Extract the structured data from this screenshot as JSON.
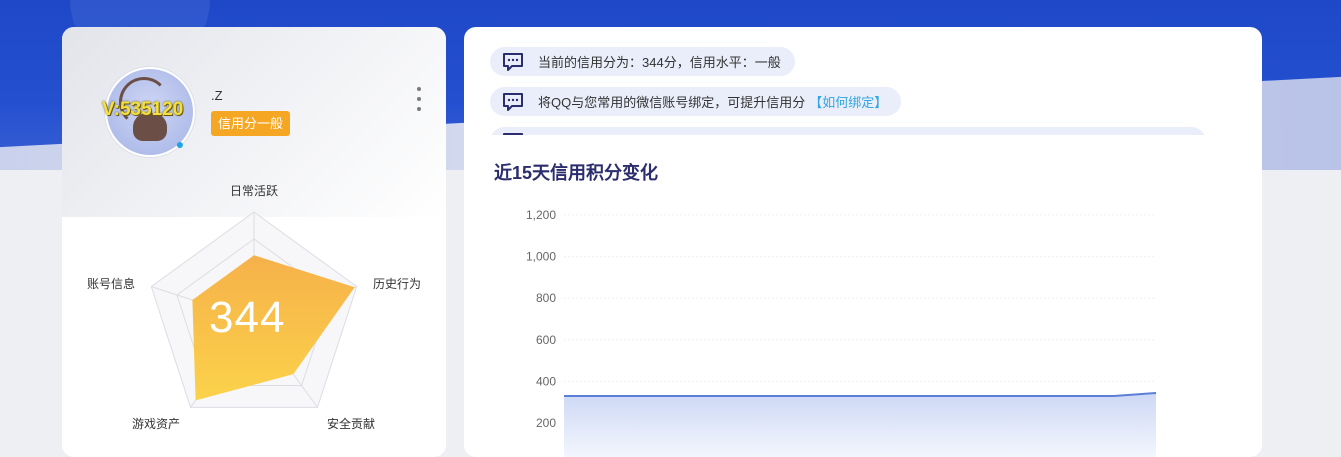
{
  "profile": {
    "vip_text": "V:535120",
    "name": ".Z",
    "credit_level_tag": "信用分一般",
    "score": "344",
    "radar": {
      "dimensions": [
        "日常活跃",
        "历史行为",
        "安全贡献",
        "游戏资产",
        "账号信息"
      ],
      "values": [
        0.6,
        0.98,
        0.62,
        0.92,
        0.6
      ]
    }
  },
  "notices": [
    {
      "text": "当前的信用分为：344分，信用水平：一般",
      "link": ""
    },
    {
      "text": "将QQ与您常用的微信账号绑定，可提升信用分",
      "link": "【如何绑定】"
    }
  ],
  "chart_section_title": "近15天信用积分变化",
  "chart_data": {
    "type": "area",
    "title": "近15天信用积分变化",
    "yticks": [
      "1,200",
      "1,000",
      "800",
      "600",
      "400",
      "200"
    ],
    "ylim": [
      0,
      1200
    ],
    "series": [
      {
        "values": [
          330,
          330,
          330,
          330,
          330,
          330,
          330,
          330,
          330,
          330,
          330,
          330,
          330,
          330,
          344
        ]
      }
    ],
    "colors": {
      "line": "#5b7fd6",
      "fill": "#dfe6f8"
    },
    "grid": true
  }
}
